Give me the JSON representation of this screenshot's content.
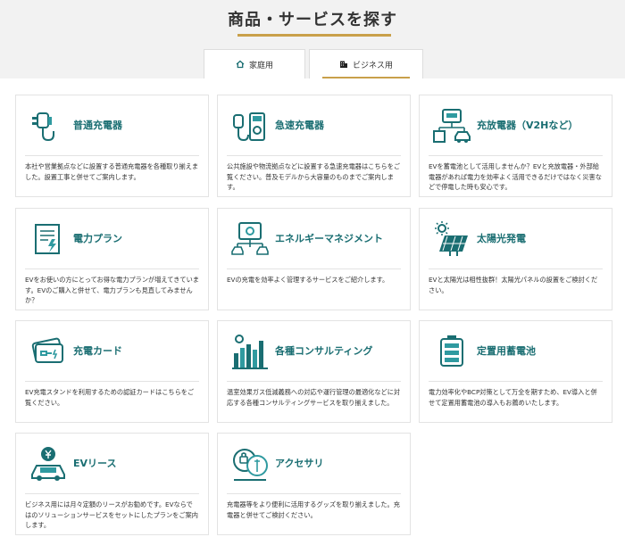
{
  "title": "商品・サービスを探す",
  "tabs": {
    "home": "家庭用",
    "business": "ビジネス用"
  },
  "cards": [
    {
      "title": "普通充電器",
      "desc": "本社や営業拠点などに設置する普通充電器を各種取り揃えました。設置工事と併せてご案内します。"
    },
    {
      "title": "急速充電器",
      "desc": "公共施設や物流拠点などに設置する急速充電器はこちらをご覧ください。普及モデルから大容量のものまでご案内します。"
    },
    {
      "title": "充放電器（V2Hなど）",
      "desc": "EVを蓄電池として活用しませんか？EVと充放電器・外部給電器があれば電力を効率よく活用できるだけではなく災害などで停電した時も安心です。"
    },
    {
      "title": "電力プラン",
      "desc": "EVをお使いの方にとってお得な電力プランが増えてきています。EVのご購入と併せて、電力プランも見直してみませんか？"
    },
    {
      "title": "エネルギーマネジメント",
      "desc": "EVの充電を効率よく管理するサービスをご紹介します。"
    },
    {
      "title": "太陽光発電",
      "desc": "EVと太陽光は相性抜群！太陽光パネルの設置をご検討ください。"
    },
    {
      "title": "充電カード",
      "desc": "EV充電スタンドを利用するための認証カードはこちらをご覧ください。"
    },
    {
      "title": "各種コンサルティング",
      "desc": "温室効果ガス低減義務への対応や運行管理の最適化などに対応する各種コンサルティングサービスを取り揃えました。"
    },
    {
      "title": "定置用蓄電池",
      "desc": "電力効率化やBCP対策として万全を期すため、EV導入と併せて定置用蓄電池の導入もお薦めいたします。"
    },
    {
      "title": "EVリース",
      "desc": "ビジネス用には月々定額のリースがお勧めです。EVならではのソリューションサービスをセットにしたプランをご案内します。"
    },
    {
      "title": "アクセサリ",
      "desc": "充電器等をより便利に活用するグッズを取り揃えました。充電器と併せてご検討ください。"
    }
  ]
}
